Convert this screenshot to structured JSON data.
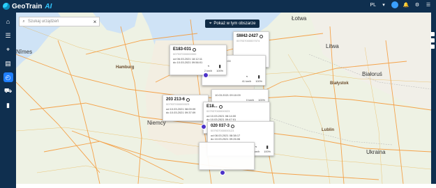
{
  "app": {
    "name": "GeoTrain",
    "suffix": "AI"
  },
  "topbar": {
    "lang": "PL"
  },
  "sidebar": {
    "items": [
      "home",
      "list",
      "map",
      "report",
      "schedule",
      "train",
      "stats"
    ]
  },
  "search": {
    "placeholder": "Szukaj urządzeń"
  },
  "area_pill": {
    "label": "Pokaż w tym obszarze"
  },
  "map_labels": [
    {
      "text": "Łotwa"
    },
    {
      "text": "Litwa"
    },
    {
      "text": "Białoruś"
    },
    {
      "text": "Niemcy"
    },
    {
      "text": "Ukraina"
    },
    {
      "text": "Białystok"
    },
    {
      "text": "Lublin"
    },
    {
      "text": "Nîmes"
    },
    {
      "text": "Hamburg"
    }
  ],
  "cards": [
    {
      "id": "SM42-2427",
      "sub": "007937000007074",
      "t1": "",
      "t2": "",
      "m1": "",
      "m2": "",
      "m3": ""
    },
    {
      "id": "E183-031",
      "sub": "007937000000000",
      "t1": "od 06.03.2021 18:12:11",
      "t2": "do 10.03.2021 09:56:01",
      "m1": "2 km/h",
      "m2": "100%",
      "m3": ""
    },
    {
      "id": "",
      "sub": "",
      "t1": "10.03.2021 08:00:00",
      "t2": "",
      "m1": "",
      "m2": "41 km/h",
      "m3": "100%"
    },
    {
      "id": "",
      "sub": "",
      "t1": "10.03.2021 09:10:09",
      "t2": "",
      "m1": "0 km/h",
      "m2": "100%",
      "m3": ""
    },
    {
      "id": "203 213-6",
      "sub": "007937000000023",
      "t1": "od 10.03.2021 08:09:09",
      "t2": "do 10.03.2021 09:37:09",
      "m1": "",
      "m2": "",
      "m3": ""
    },
    {
      "id": "E18...",
      "sub": "007937000000023",
      "t1": "od 10.03.2021 08:14:00",
      "t2": "do 10.03.2021 09:47:01",
      "m1": "0 km/h",
      "m2": "100%",
      "m3": ""
    },
    {
      "id": "020 037-3",
      "sub": "007937000000123",
      "t1": "od 08.03.2021 08:38:17",
      "t2": "do 10.03.2021 09:26:06",
      "m1": "0 km/h",
      "m2": "100%",
      "m3": ""
    }
  ]
}
